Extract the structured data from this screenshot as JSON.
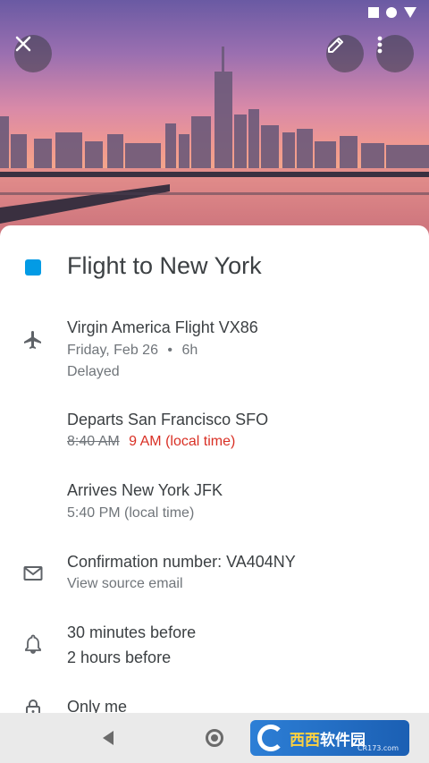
{
  "event": {
    "title": "Flight to New York",
    "color": "#039be5"
  },
  "flight": {
    "name": "Virgin America Flight VX86",
    "date": "Friday, Feb 26",
    "separator": "•",
    "duration": "6h",
    "status": "Delayed"
  },
  "departure": {
    "label": "Departs San Francisco SFO",
    "old_time": "8:40 AM",
    "new_time": "9 AM (local time)"
  },
  "arrival": {
    "label": "Arrives New York JFK",
    "time": "5:40 PM (local time)"
  },
  "confirmation": {
    "label": "Confirmation number: VA404NY",
    "link": "View source email"
  },
  "reminders": {
    "first": "30 minutes before",
    "second": "2 hours before"
  },
  "visibility": {
    "label": "Only me"
  },
  "watermark": {
    "logo_text_a": "西西",
    "logo_text_b": "软件园",
    "url": "CR173.com"
  },
  "icons": {
    "close": "close-icon",
    "edit": "pencil-icon",
    "more": "more-vert-icon",
    "flight": "airplane-icon",
    "email": "mail-icon",
    "bell": "bell-icon",
    "lock": "lock-icon"
  }
}
